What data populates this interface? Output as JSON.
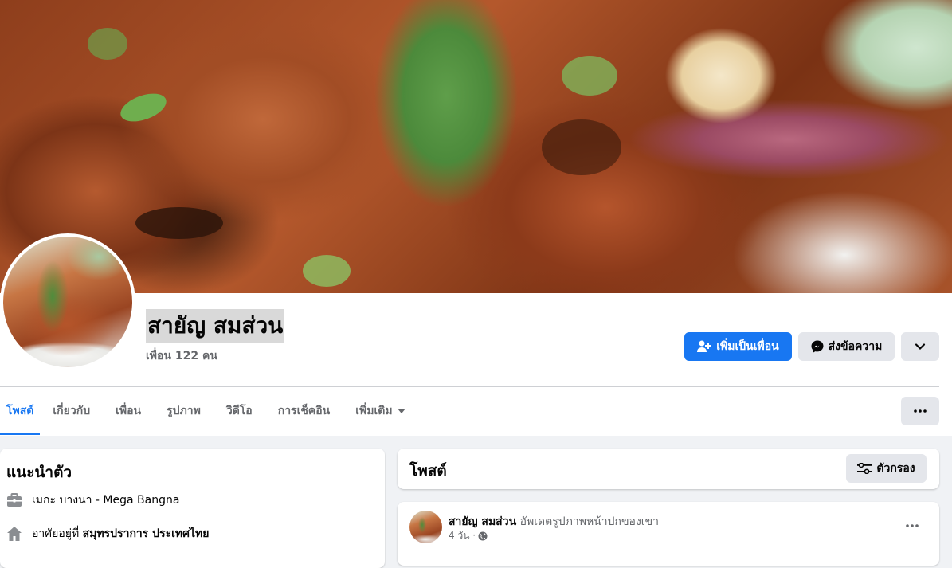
{
  "profile": {
    "name": "สายัญ สมส่วน",
    "friends": "เพื่อน 122 คน"
  },
  "actions": {
    "add_friend": "เพิ่มเป็นเพื่อน",
    "message": "ส่งข้อความ"
  },
  "tabs": [
    {
      "label": "โพสต์"
    },
    {
      "label": "เกี่ยวกับ"
    },
    {
      "label": "เพื่อน"
    },
    {
      "label": "รูปภาพ"
    },
    {
      "label": "วิดีโอ"
    },
    {
      "label": "การเช็คอิน"
    },
    {
      "label": "เพิ่มเติม"
    }
  ],
  "intro": {
    "title": "แนะนำตัว",
    "work": "เมกะ บางนา - Mega Bangna",
    "lives_prefix": "อาศัยอยู่ที่",
    "lives_place": "สมุทรปราการ ประเทศไทย"
  },
  "posts": {
    "title": "โพสต์",
    "filter_label": "ตัวกรอง"
  },
  "post": {
    "author": "สายัญ สมส่วน",
    "action": "อัพเดตรูปภาพหน้าปกของเขา",
    "time": "4 วัน ·"
  },
  "colors": {
    "accent": "#1877f2",
    "secondary_button": "#e4e6eb",
    "muted_text": "#65676b",
    "page_background": "#f0f2f5"
  },
  "icons": [
    "add-friend-icon",
    "messenger-icon",
    "chevron-down-icon",
    "more-dots-icon",
    "briefcase-icon",
    "home-icon",
    "filter-icon",
    "globe-icon",
    "caret-down-icon"
  ]
}
